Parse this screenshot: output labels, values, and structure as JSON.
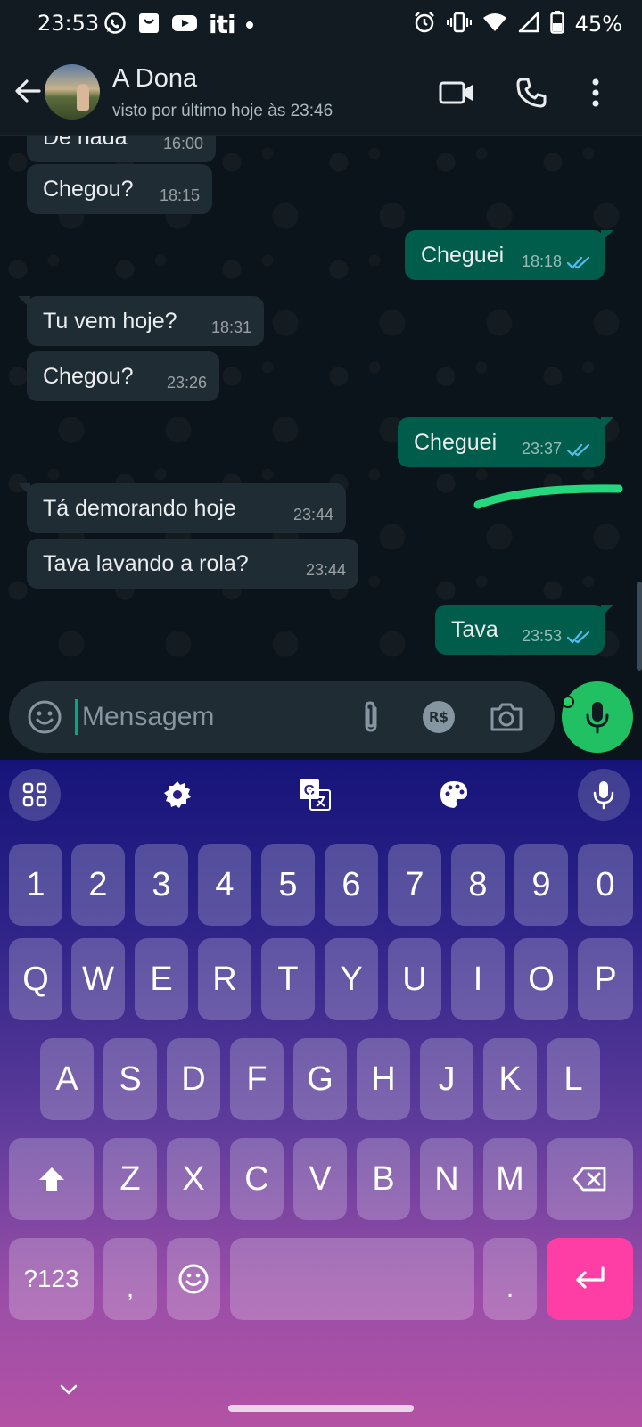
{
  "status_bar": {
    "time": "23:53",
    "battery": "45%",
    "left_icons": [
      "whatsapp-icon",
      "store-icon",
      "youtube-icon",
      "iti-icon",
      "notification-dot"
    ],
    "right_icons": [
      "alarm-icon",
      "vibrate-icon",
      "wifi-icon",
      "signal-icon",
      "battery-icon"
    ],
    "iti_label": "iti"
  },
  "header": {
    "contact_name": "A Dona",
    "last_seen": "visto por último hoje às 23:46",
    "actions": [
      "back-arrow-icon",
      "video-call-icon",
      "voice-call-icon",
      "more-options-icon"
    ]
  },
  "messages": [
    {
      "dir": "in",
      "text": "De nada",
      "time": "16:00"
    },
    {
      "dir": "in",
      "text": "Chegou?",
      "time": "18:15"
    },
    {
      "dir": "out",
      "text": "Cheguei",
      "time": "18:18",
      "status": "read"
    },
    {
      "dir": "in",
      "text": "Tu vem hoje?",
      "time": "18:31"
    },
    {
      "dir": "in",
      "text": "Chegou?",
      "time": "23:26"
    },
    {
      "dir": "out",
      "text": "Cheguei",
      "time": "23:37",
      "status": "read"
    },
    {
      "dir": "in",
      "text": "Tá demorando hoje",
      "time": "23:44"
    },
    {
      "dir": "in",
      "text": "Tava lavando a rola?",
      "time": "23:44"
    },
    {
      "dir": "out",
      "text": "Tava",
      "time": "23:53",
      "status": "read"
    }
  ],
  "composer": {
    "placeholder": "Mensagem",
    "value": "",
    "pix_label": "R$",
    "icons": [
      "emoji-icon",
      "attach-icon",
      "pix-payment-icon",
      "camera-icon",
      "mic-icon"
    ]
  },
  "keyboard": {
    "toolbar": [
      "apps-grid-icon",
      "settings-gear-icon",
      "translate-icon",
      "palette-icon",
      "voice-input-icon"
    ],
    "row_numbers": [
      "1",
      "2",
      "3",
      "4",
      "5",
      "6",
      "7",
      "8",
      "9",
      "0"
    ],
    "row_1": [
      "Q",
      "W",
      "E",
      "R",
      "T",
      "Y",
      "U",
      "I",
      "O",
      "P"
    ],
    "row_2": [
      "A",
      "S",
      "D",
      "F",
      "G",
      "H",
      "J",
      "K",
      "L"
    ],
    "row_3": [
      "Z",
      "X",
      "C",
      "V",
      "B",
      "N",
      "M"
    ],
    "symbols_label": "?123",
    "comma_label": ",",
    "period_label": "."
  },
  "colors": {
    "header_bg": "#111b21",
    "chat_bg": "#0b141a",
    "incoming_bubble": "#202c33",
    "outgoing_bubble": "#005c4b",
    "read_ticks": "#53bdeb",
    "accent_green": "#21c063",
    "enter_key": "#ff3ea5"
  }
}
